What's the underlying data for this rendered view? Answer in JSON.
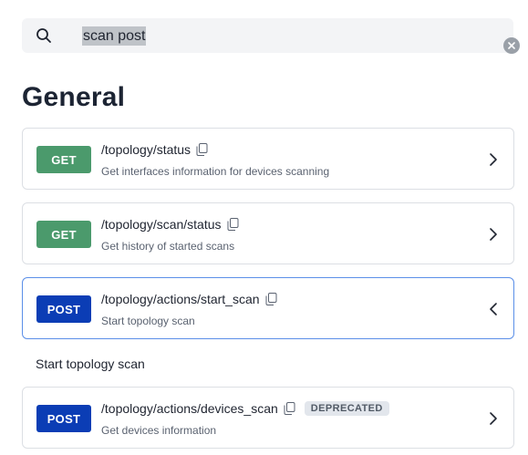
{
  "search": {
    "value": "scan post",
    "icon": "search-icon",
    "clear_icon": "clear-icon"
  },
  "section": {
    "title": "General"
  },
  "colors": {
    "get": "#4b9a6c",
    "post": "#0b3db5",
    "active_border": "#5b8fe8"
  },
  "endpoints": [
    {
      "method": "GET",
      "path": "/topology/status",
      "description": "Get interfaces information for devices scanning",
      "expanded": false
    },
    {
      "method": "GET",
      "path": "/topology/scan/status",
      "description": "Get history of started scans",
      "expanded": false
    },
    {
      "method": "POST",
      "path": "/topology/actions/start_scan",
      "description": "Start topology scan",
      "expanded": true
    },
    {
      "method": "POST",
      "path": "/topology/actions/devices_scan",
      "description": "Get devices information",
      "badge": "DEPRECATED",
      "expanded": false
    }
  ],
  "expanded_detail": {
    "text": "Start topology scan"
  }
}
